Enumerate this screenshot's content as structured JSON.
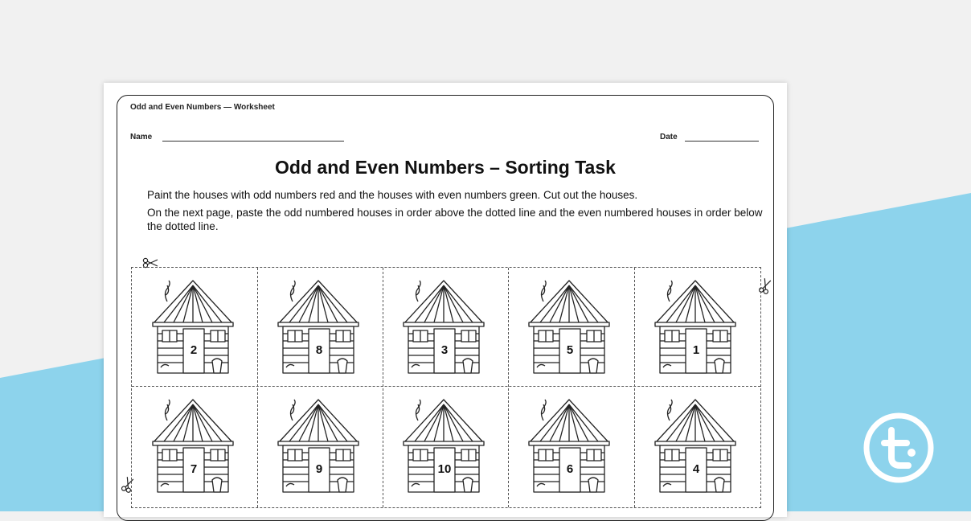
{
  "worksheet": {
    "header_title": "Odd and Even Numbers — Worksheet",
    "name_label": "Name",
    "date_label": "Date",
    "title": "Odd and Even Numbers – Sorting Task",
    "instruction_1": "Paint the houses with odd numbers red and the houses with even numbers green. Cut out the houses.",
    "instruction_2": "On the next page, paste the odd numbered houses in order above the dotted line and the even numbered houses in order below the dotted line."
  },
  "houses": [
    "2",
    "8",
    "3",
    "5",
    "1",
    "7",
    "9",
    "10",
    "6",
    "4"
  ],
  "colors": {
    "background": "#f1f1f1",
    "accent_band": "#8dd3ec",
    "sheet": "#ffffff",
    "logo_ring": "#ffffff"
  },
  "icons": [
    "scissors-icon",
    "house-icon",
    "teachstarter-logo-icon"
  ]
}
